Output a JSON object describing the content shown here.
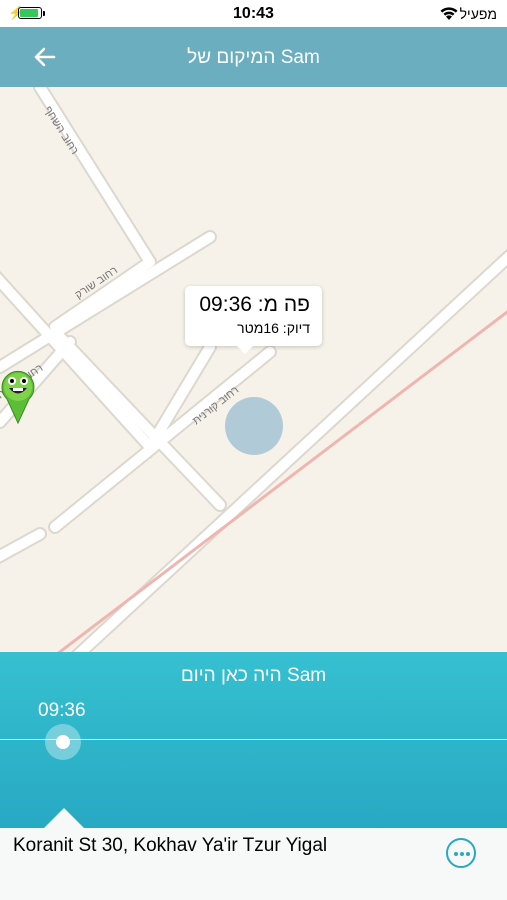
{
  "status_bar": {
    "time": "10:43",
    "carrier": "מפעיל"
  },
  "header": {
    "title": "המיקום של Sam"
  },
  "map": {
    "streets": [
      "רחוב השחף",
      "רחוב שורק",
      "רחוב נחל ה",
      "רחוב קורנית"
    ],
    "callout_line1": "פה מ: 09:36",
    "callout_line2": "דיוק: 16מטר"
  },
  "timeline": {
    "title": "Sam היה כאן היום",
    "time_label": "09:36"
  },
  "footer": {
    "address": "Koranit St 30, Kokhav Ya'ir Tzur Yigal"
  },
  "colors": {
    "header": "#6aaec0",
    "panel": "#2eb6cb",
    "accent": "#27a9c3"
  },
  "icons": {
    "back": "arrow-left-icon",
    "more": "more-horizontal-icon",
    "pin": "green-face-pin-icon"
  }
}
